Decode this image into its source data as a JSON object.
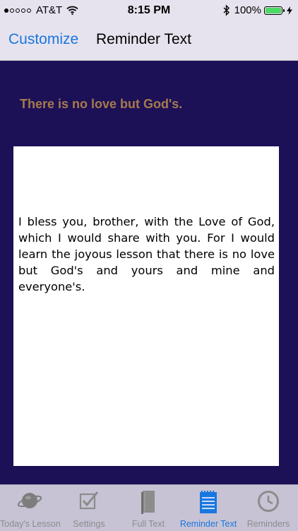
{
  "status": {
    "carrier": "AT&T",
    "time": "8:15 PM",
    "battery": "100%",
    "signal_bars_filled": 1,
    "signal_bars_total": 5,
    "battery_level": 1.0,
    "battery_color": "#4cd964"
  },
  "nav": {
    "back_label": "Customize",
    "title": "Reminder Text",
    "back_color": "#1a76e0"
  },
  "content": {
    "headline": "There is no love but God's.",
    "headline_color": "#a77a4c",
    "body": "I bless you, brother, with the Love of God, which I would share with you. For I would learn the joyous lesson that there is no love but God's and yours and mine and everyone's."
  },
  "tabs": [
    {
      "label": "Today's Lesson",
      "icon": "planet-icon",
      "active": false
    },
    {
      "label": "Settings",
      "icon": "checkbox-icon",
      "active": false
    },
    {
      "label": "Full Text",
      "icon": "book-icon",
      "active": false
    },
    {
      "label": "Reminder Text",
      "icon": "notepad-icon",
      "active": true
    },
    {
      "label": "Reminders",
      "icon": "clock-icon",
      "active": false
    }
  ],
  "colors": {
    "active_tab": "#1977e0",
    "inactive_tab": "#8c8c8c",
    "background": "#1c1057"
  }
}
